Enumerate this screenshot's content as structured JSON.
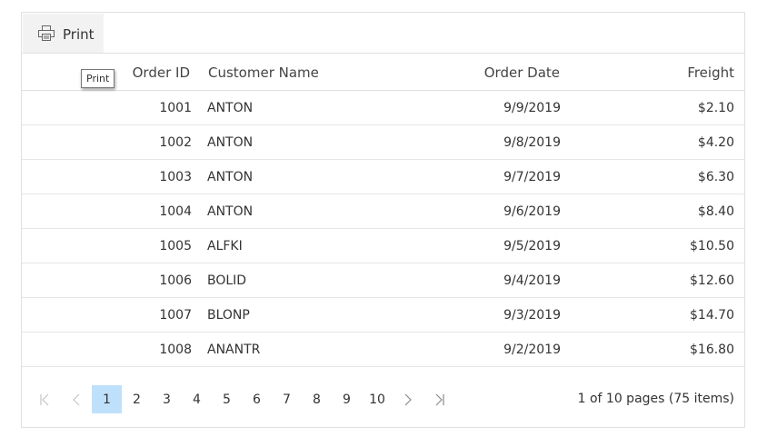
{
  "toolbar": {
    "print_label": "Print",
    "print_icon": "printer-icon"
  },
  "tooltip": {
    "text": "Print"
  },
  "columns": {
    "order_id": "Order ID",
    "customer_name": "Customer Name",
    "order_date": "Order Date",
    "freight": "Freight"
  },
  "rows": [
    {
      "id": "1001",
      "name": "ANTON",
      "date": "9/9/2019",
      "freight": "$2.10"
    },
    {
      "id": "1002",
      "name": "ANTON",
      "date": "9/8/2019",
      "freight": "$4.20"
    },
    {
      "id": "1003",
      "name": "ANTON",
      "date": "9/7/2019",
      "freight": "$6.30"
    },
    {
      "id": "1004",
      "name": "ANTON",
      "date": "9/6/2019",
      "freight": "$8.40"
    },
    {
      "id": "1005",
      "name": "ALFKI",
      "date": "9/5/2019",
      "freight": "$10.50"
    },
    {
      "id": "1006",
      "name": "BOLID",
      "date": "9/4/2019",
      "freight": "$12.60"
    },
    {
      "id": "1007",
      "name": "BLONP",
      "date": "9/3/2019",
      "freight": "$14.70"
    },
    {
      "id": "1008",
      "name": "ANANTR",
      "date": "9/2/2019",
      "freight": "$16.80"
    }
  ],
  "pager": {
    "first": "K",
    "prev": "‹",
    "next": "›",
    "last": "›|",
    "pages": [
      "1",
      "2",
      "3",
      "4",
      "5",
      "6",
      "7",
      "8",
      "9",
      "10"
    ],
    "current_page": "1",
    "info": "1 of 10 pages (75 items)"
  },
  "colors": {
    "selected_page_bg": "#bfe0fb",
    "toolbar_btn_bg": "#f2f2f2",
    "border": "#e0e0e0"
  }
}
